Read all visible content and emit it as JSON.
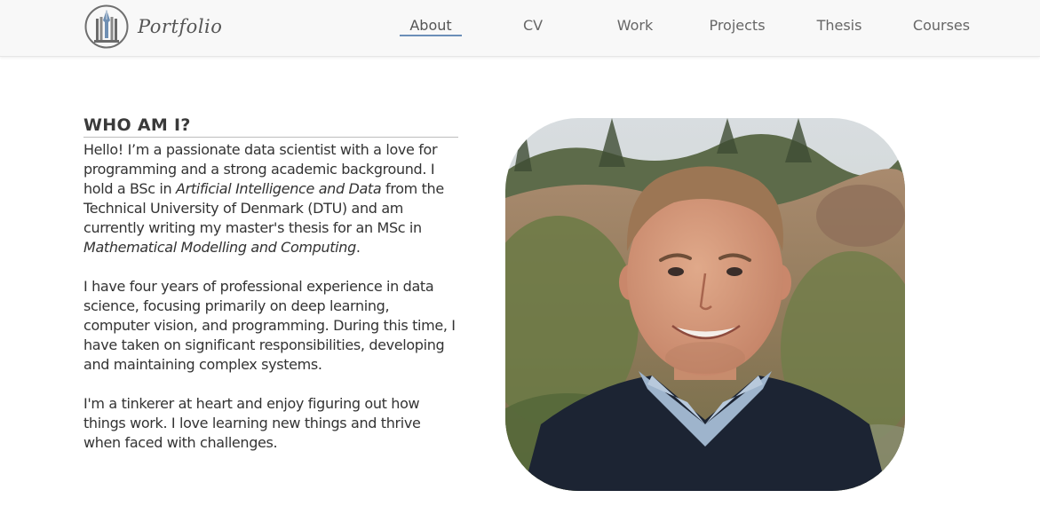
{
  "brand": {
    "text": "Portfolio",
    "logo_icon": "fountain-pen-logo-icon"
  },
  "nav": {
    "items": [
      {
        "label": "About",
        "active": true
      },
      {
        "label": "CV",
        "active": false
      },
      {
        "label": "Work",
        "active": false
      },
      {
        "label": "Projects",
        "active": false
      },
      {
        "label": "Thesis",
        "active": false
      },
      {
        "label": "Courses",
        "active": false
      }
    ]
  },
  "about": {
    "heading": "WHO AM I?",
    "p1": {
      "a": "Hello! I’m a passionate data scientist with a love for programming and a strong academic background. I hold a BSc in ",
      "b": "Artificial Intelligence and Data",
      "c": " from the Technical University of Denmark (DTU) and am currently writing my master's thesis for an MSc in ",
      "d": "Mathematical Modelling and Computing",
      "e": "."
    },
    "p2": "I have four years of professional experience in data science, focusing primarily on deep learning, computer vision, and programming. During this time, I have taken on significant responsibilities, developing and maintaining complex systems.",
    "p3": "I'm a tinkerer at heart and enjoy figuring out how things work. I love learning new things and thrive when faced with challenges."
  },
  "colors": {
    "accent_underline": "#6b8fb8",
    "navbar_bg": "#f8f8f8",
    "text": "#333333"
  }
}
